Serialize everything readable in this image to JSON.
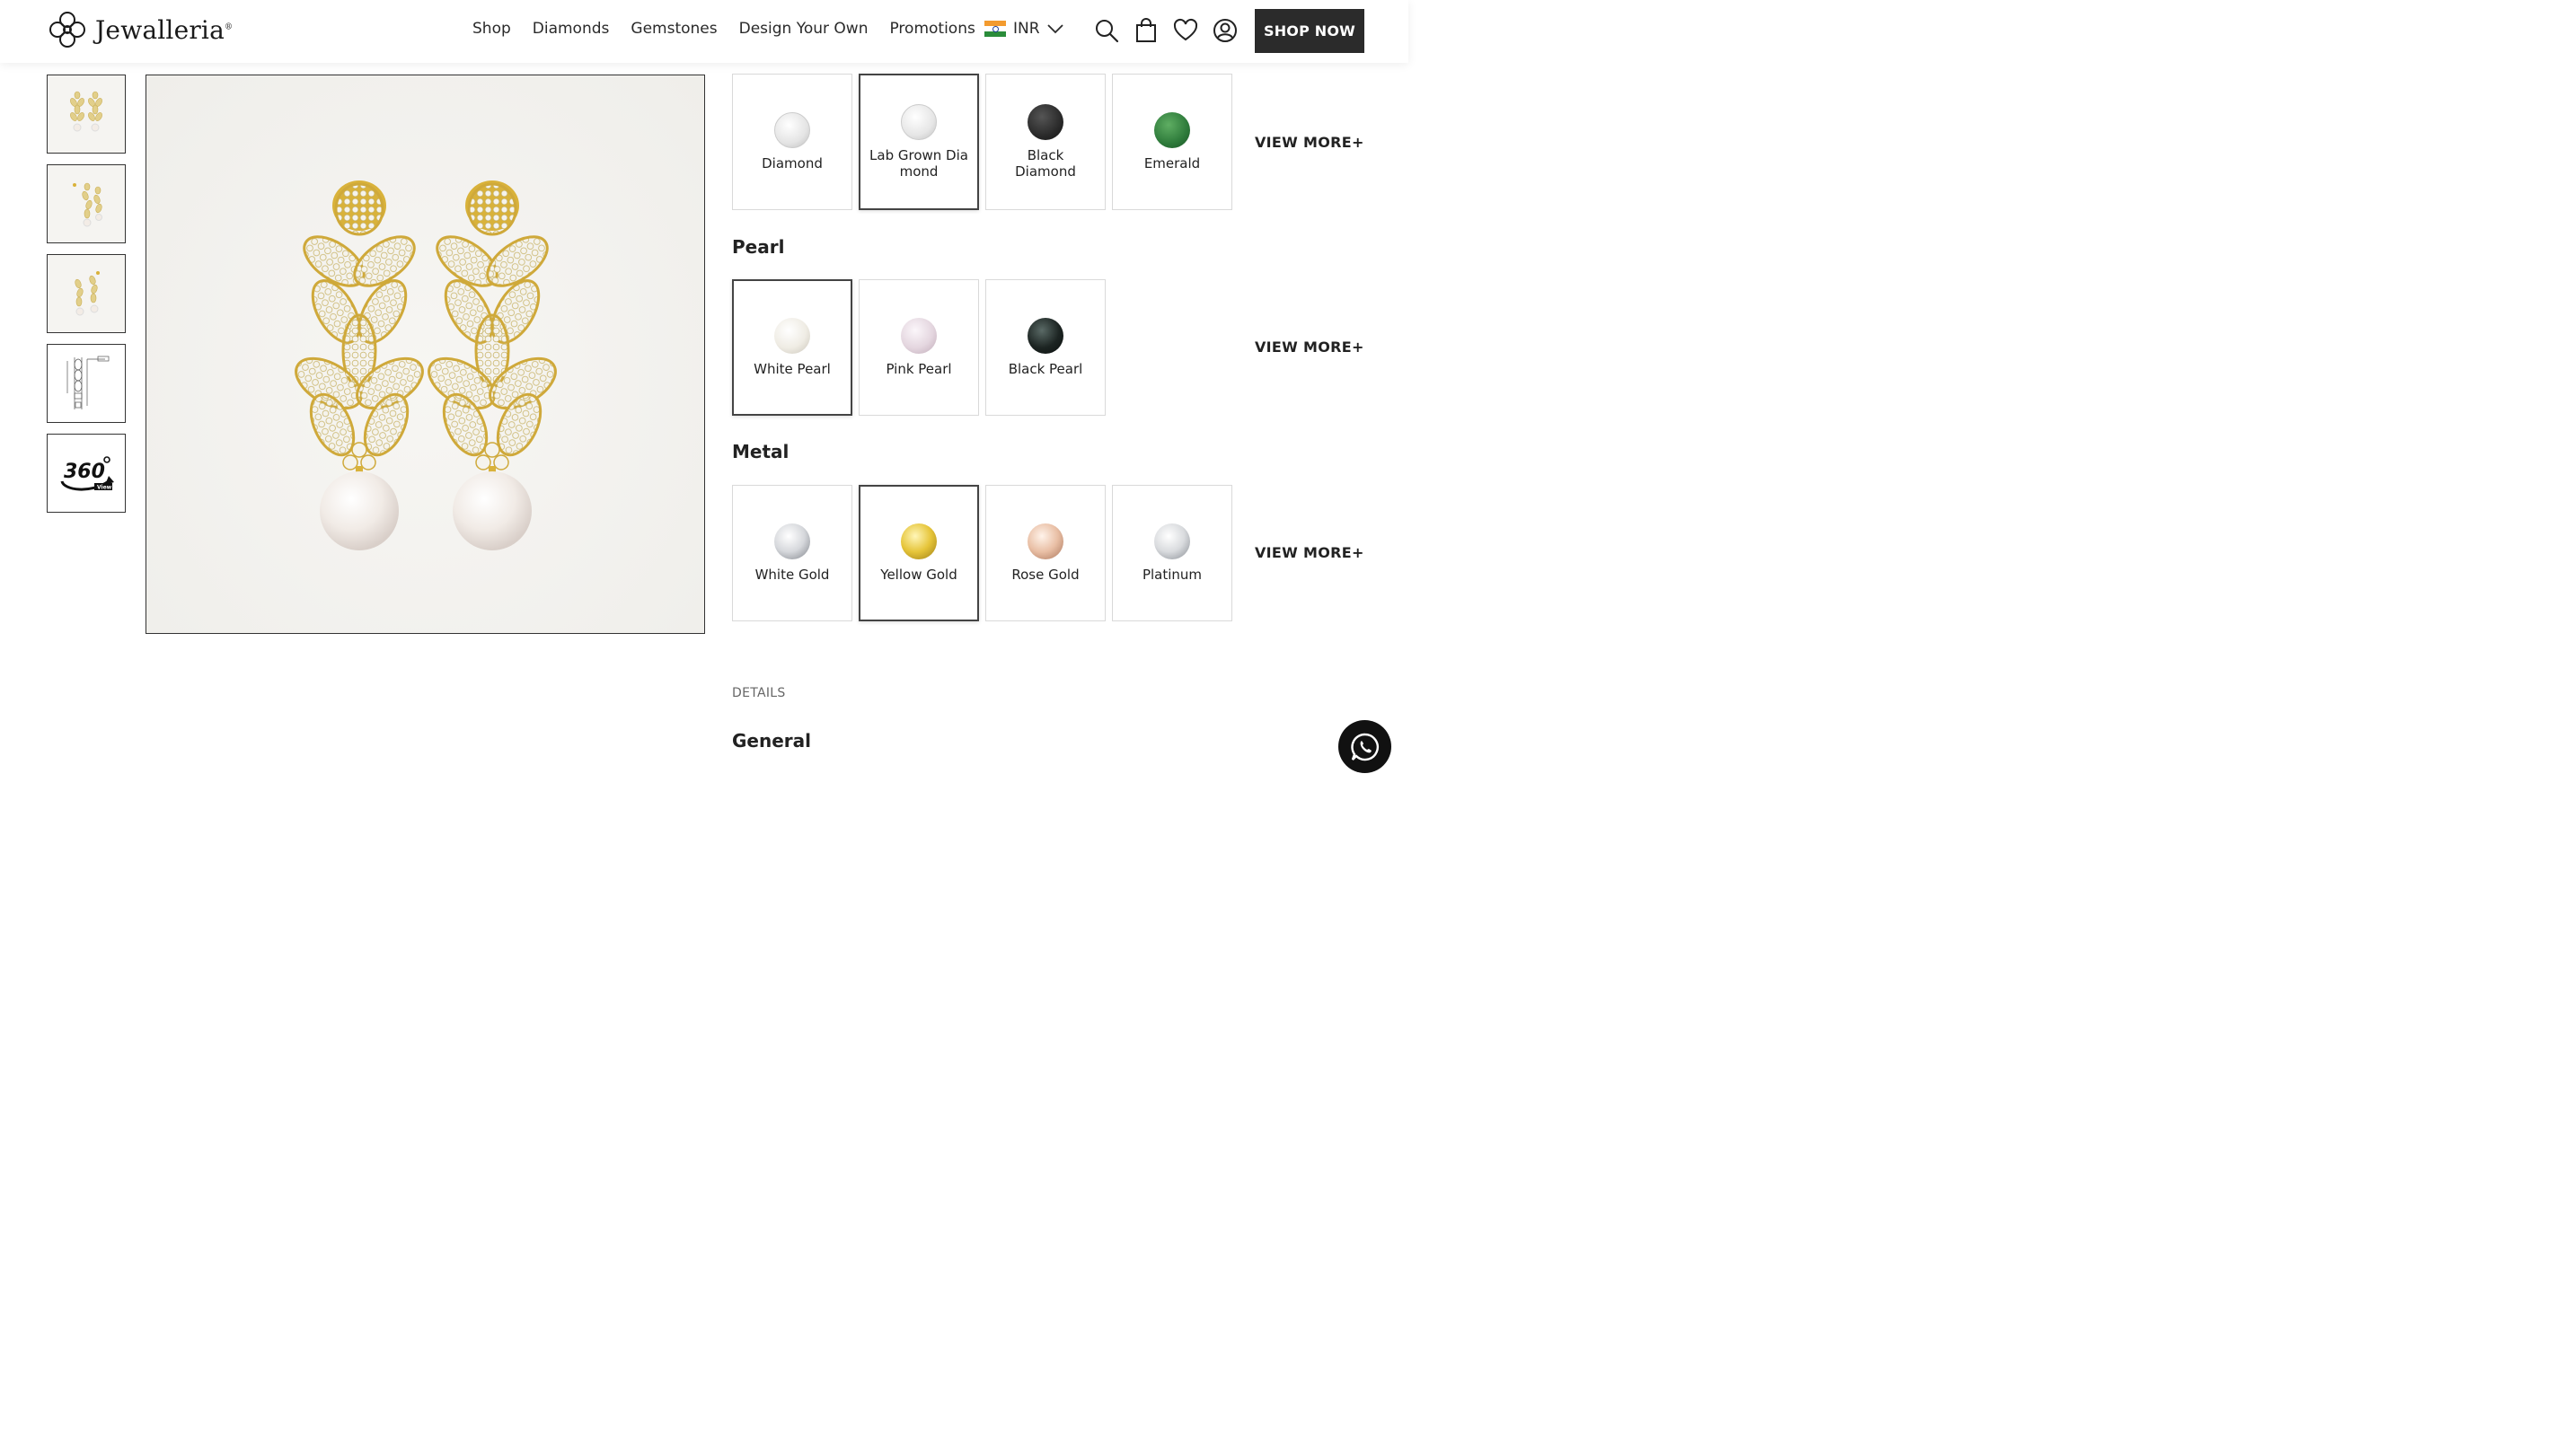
{
  "brand": {
    "name": "Jewalleria",
    "registered_mark": "®"
  },
  "nav": {
    "items": [
      {
        "label": "Shop"
      },
      {
        "label": "Diamonds"
      },
      {
        "label": "Gemstones"
      },
      {
        "label": "Design Your Own"
      },
      {
        "label": "Promotions"
      }
    ],
    "currency": "INR",
    "shop_now": "SHOP NOW",
    "icons": [
      "search-icon",
      "cart-icon",
      "wishlist-heart-icon",
      "account-icon",
      "chevron-down-icon",
      "india-flag-icon"
    ]
  },
  "gallery": {
    "thumbnails": [
      "earrings-front-view",
      "earrings-angle-view",
      "earrings-side-view",
      "technical-drawing",
      "360-view"
    ],
    "view360_label": "360",
    "view360_sub": "View"
  },
  "stones": {
    "options": [
      {
        "label": "Diamond",
        "color": "#e8e8e8",
        "selected": false
      },
      {
        "label": "Lab Grown Dia mond",
        "color": "#e8e8e8",
        "selected": true
      },
      {
        "label": "Black Diamond",
        "color": "#2a2a2a",
        "selected": false
      },
      {
        "label": "Emerald",
        "color": "#2d7a3a",
        "selected": false
      }
    ],
    "view_more": "VIEW MORE+"
  },
  "pearl": {
    "title": "Pearl",
    "options": [
      {
        "label": "White Pearl",
        "color": "#efece4",
        "selected": true
      },
      {
        "label": "Pink Pearl",
        "color": "#e4d6df",
        "selected": false
      },
      {
        "label": "Black Pearl",
        "color": "#1c2422",
        "selected": false
      }
    ],
    "view_more": "VIEW MORE+"
  },
  "metal": {
    "title": "Metal",
    "options": [
      {
        "label": "White Gold",
        "color": "#d6d8dc",
        "selected": false
      },
      {
        "label": "Yellow Gold",
        "color": "#e6c53a",
        "selected": true
      },
      {
        "label": "Rose Gold",
        "color": "#e9bfa5",
        "selected": false
      },
      {
        "label": "Platinum",
        "color": "#d9dbde",
        "selected": false
      }
    ],
    "view_more": "VIEW MORE+"
  },
  "details": {
    "label": "DETAILS",
    "general_title": "General"
  },
  "colors": {
    "accent": "#2b2b2b",
    "border": "#d9d9d9",
    "gold": "#d9b23a"
  }
}
